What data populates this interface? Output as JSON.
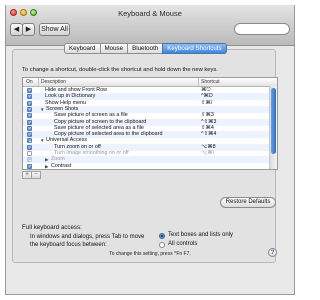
{
  "window": {
    "title": "Keyboard & Mouse"
  },
  "toolbar": {
    "back_label": "◀",
    "forward_label": "▶",
    "show_all_label": "Show All",
    "search_placeholder": "",
    "search_value": ""
  },
  "tabs": [
    {
      "label": "Keyboard",
      "active": false
    },
    {
      "label": "Mouse",
      "active": false
    },
    {
      "label": "Bluetooth",
      "active": false
    },
    {
      "label": "Keyboard Shortcuts",
      "active": true
    }
  ],
  "instructions": "To change a shortcut, double-click the shortcut and hold down the new keys.",
  "table": {
    "columns": {
      "on": "On",
      "description": "Description",
      "shortcut": "Shortcut"
    },
    "rows": [
      {
        "checked": true,
        "description": "Hide and show Front Row",
        "shortcut": "⌘⎋",
        "indent": 0,
        "group": false,
        "enabled": true
      },
      {
        "checked": true,
        "description": "Look up in Dictionary",
        "shortcut": "^⌘D",
        "indent": 0,
        "group": false,
        "enabled": true
      },
      {
        "checked": true,
        "description": "Show Help menu",
        "shortcut": "⇧⌘/",
        "indent": 0,
        "group": false,
        "enabled": true
      },
      {
        "checked": true,
        "description": "Screen Shots",
        "shortcut": "",
        "indent": 0,
        "group": true,
        "expanded": true,
        "enabled": true
      },
      {
        "checked": true,
        "description": "Save picture of screen as a file",
        "shortcut": "⇧⌘3",
        "indent": 1,
        "group": false,
        "enabled": true
      },
      {
        "checked": true,
        "description": "Copy picture of screen to the clipboard",
        "shortcut": "^⇧⌘3",
        "indent": 1,
        "group": false,
        "enabled": true
      },
      {
        "checked": true,
        "description": "Save picture of selected area as a file",
        "shortcut": "⇧⌘4",
        "indent": 1,
        "group": false,
        "enabled": true
      },
      {
        "checked": true,
        "description": "Copy picture of selected area to the clipboard",
        "shortcut": "^⇧⌘4",
        "indent": 1,
        "group": false,
        "enabled": true
      },
      {
        "checked": "mixed",
        "description": "Universal Access",
        "shortcut": "",
        "indent": 0,
        "group": true,
        "expanded": true,
        "enabled": true
      },
      {
        "checked": true,
        "description": "Turn zoom on or off",
        "shortcut": "⌥⌘8",
        "indent": 1,
        "group": false,
        "enabled": true
      },
      {
        "checked": false,
        "description": "Turn image smoothing on or off",
        "shortcut": "⌥⌘\\",
        "indent": 1,
        "group": false,
        "enabled": false
      },
      {
        "checked": "dim",
        "description": "Zoom",
        "shortcut": "",
        "indent": 1,
        "group": true,
        "expanded": false,
        "enabled": false
      },
      {
        "checked": true,
        "description": "Contrast",
        "shortcut": "",
        "indent": 1,
        "group": true,
        "expanded": false,
        "enabled": true
      }
    ]
  },
  "buttons": {
    "add_label": "+",
    "remove_label": "−",
    "restore_defaults_label": "Restore Defaults"
  },
  "full_keyboard_access": {
    "label": "Full keyboard access:",
    "description": "In windows and dialogs, press Tab to move the keyboard focus between:",
    "options": [
      {
        "label": "Text boxes and lists only",
        "selected": true
      },
      {
        "label": "All controls",
        "selected": false
      }
    ],
    "hint": "To change this setting, press ^Fn F7."
  },
  "help_label": "?",
  "colors": {
    "accent": "#3f86dd",
    "selection_alt_row": "#edf3fe"
  }
}
